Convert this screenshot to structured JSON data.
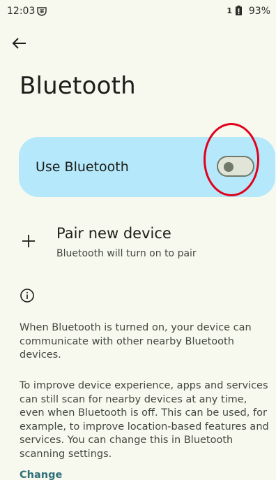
{
  "status_bar": {
    "time": "12:03",
    "sim_indicator": "1",
    "battery_percent": "93%",
    "icons": [
      "vpn-key-icon",
      "battery-icon"
    ]
  },
  "header": {
    "back_icon": "arrow-back-icon",
    "title": "Bluetooth"
  },
  "main_toggle": {
    "label": "Use Bluetooth",
    "state": "off",
    "card_color": "#b4e8fa"
  },
  "pair_device": {
    "icon": "plus-icon",
    "title": "Pair new device",
    "subtitle": "Bluetooth will turn on to pair"
  },
  "footer": {
    "icon": "info-icon",
    "paragraph1": "When Bluetooth is turned on, your device can communicate with other nearby Bluetooth devices.",
    "paragraph2": "To improve device experience, apps and services can still scan for nearby devices at any time, even when Bluetooth is off. This can be used, for example, to improve location-based features and services. You can change this in Bluetooth scanning settings.",
    "link": "Change"
  },
  "annotation": {
    "highlight_color": "#e2001b"
  }
}
